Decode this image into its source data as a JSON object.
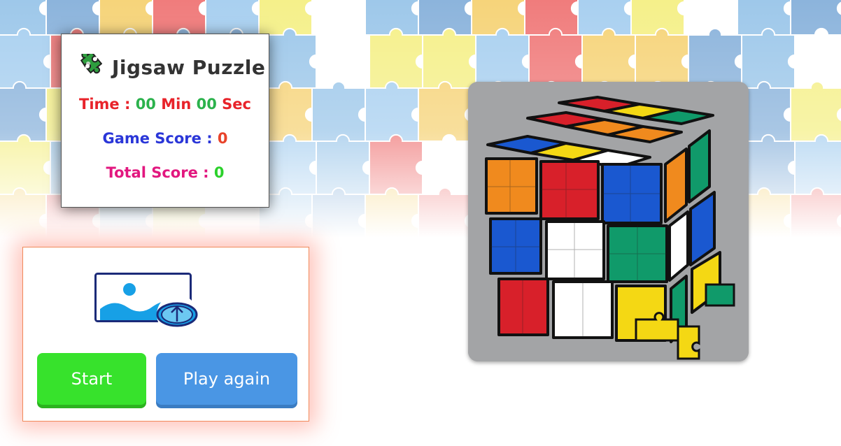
{
  "app": {
    "title": "Jigsaw Puzzle",
    "title_icon": "puzzle-piece-icon"
  },
  "scores": {
    "time_label": "Time :",
    "minutes": "00",
    "min_label": "Min",
    "seconds": "00",
    "sec_label": "Sec",
    "game_score_label": "Game Score :",
    "game_score": "0",
    "total_score_label": "Total Score :",
    "total_score": "0"
  },
  "controls": {
    "upload_icon": "image-upload-icon",
    "start_label": "Start",
    "play_again_label": "Play again"
  },
  "preview": {
    "image": "rubiks-cube-jigsaw-preview"
  },
  "colors": {
    "start": "#37e22c",
    "play_again": "#4a96e4",
    "time_text": "#e8232a",
    "game_score_text": "#2a36d8",
    "total_score_text": "#e2177f"
  }
}
